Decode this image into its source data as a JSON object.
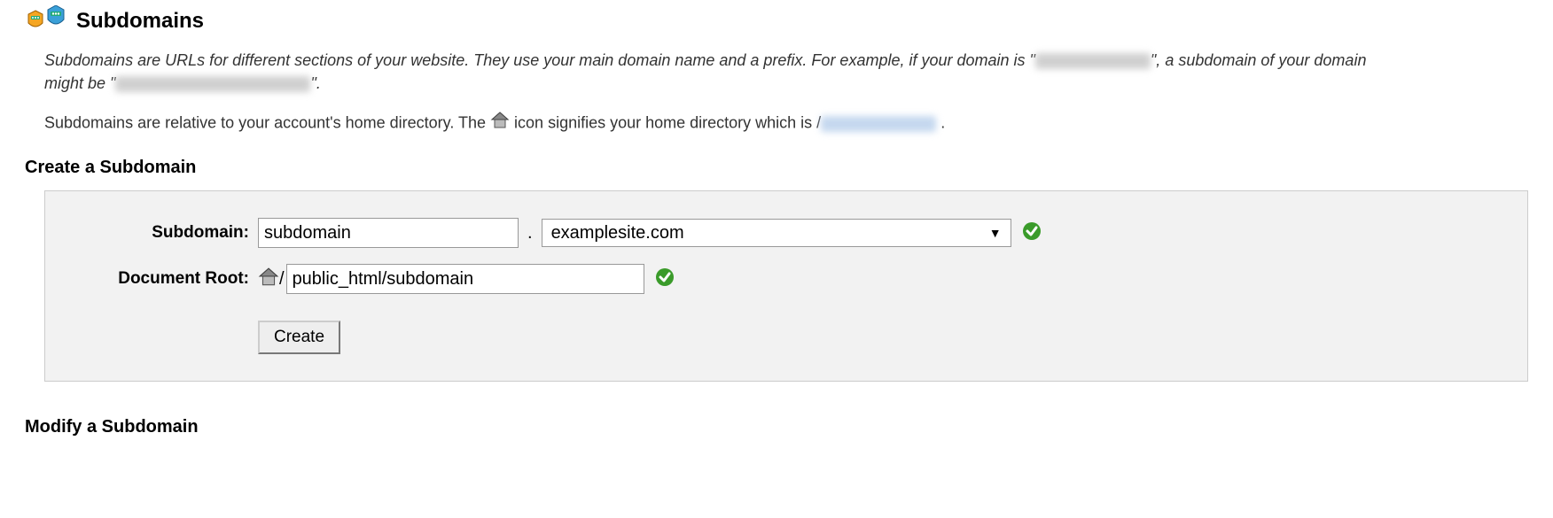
{
  "header": {
    "title": "Subdomains"
  },
  "intro": {
    "line1a": "Subdomains are URLs for different sections of your website. They use your main domain name and a prefix. For example, if your domain is \"",
    "line1b": "\", a subdomain of your domain might be \"",
    "line1c": "\".",
    "line2a": "Subdomains are relative to your account's home directory. The ",
    "line2b": " icon signifies your home directory which is /",
    "line2c": " ."
  },
  "sections": {
    "create": "Create a Subdomain",
    "modify": "Modify a Subdomain"
  },
  "form": {
    "labels": {
      "subdomain": "Subdomain:",
      "docroot": "Document Root:"
    },
    "subdomain_value": "subdomain",
    "domain_select_value": "examplesite.com",
    "docroot_prefix": "/",
    "docroot_value": "public_html/subdomain",
    "create_button": "Create"
  }
}
